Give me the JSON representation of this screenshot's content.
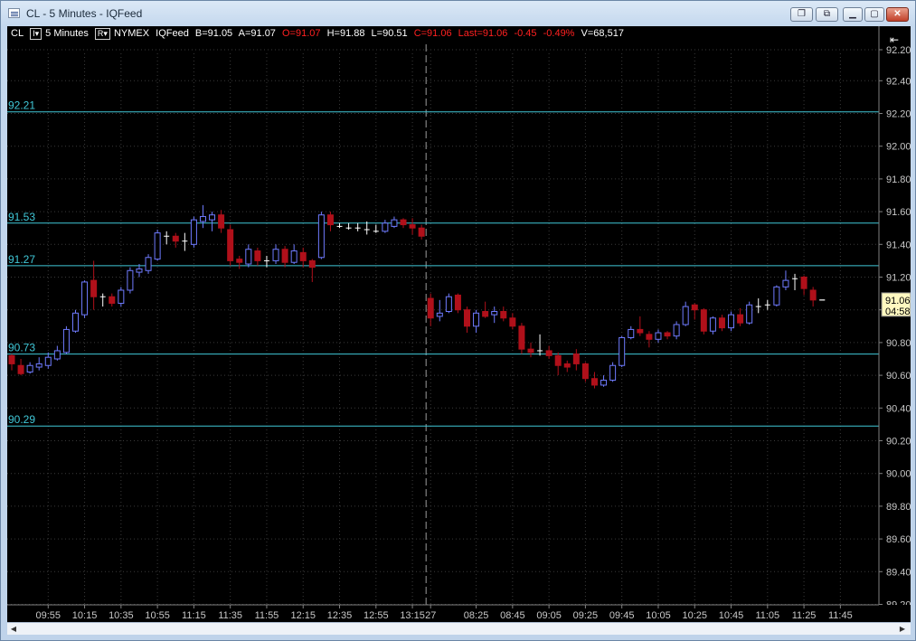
{
  "window": {
    "title": "CL - 5 Minutes - IQFeed",
    "buttons": [
      "restore-window",
      "tile-windows",
      "minimize",
      "maximize",
      "close"
    ]
  },
  "info_bar": {
    "symbol": "CL",
    "interval": "5 Minutes",
    "exchange": "NYMEX",
    "feed": "IQFeed",
    "bid": "B=91.05",
    "ask": "A=91.07",
    "open": "O=91.07",
    "high": "H=91.88",
    "low": "L=90.51",
    "close": "C=91.06",
    "last": "Last=91.06",
    "change": "-0.45",
    "change_pct": "-0.49%",
    "volume": "V=68,517",
    "box1": "I▾",
    "box2": "R▾"
  },
  "colors": {
    "up_candle": "#6f7bff",
    "down_candle": "#b0101a",
    "level_line": "#40c8d8",
    "axis_text": "#c8c8c8",
    "price_tag_bg": "#fff8c0"
  },
  "chart_data": {
    "type": "candlestick",
    "ylim": [
      89.2,
      92.3
    ],
    "y_ticks": [
      "92.20",
      "92.40",
      "92.20",
      "92.00",
      "91.80",
      "91.60",
      "91.40",
      "91.20",
      "91.00",
      "90.80",
      "90.60",
      "90.40",
      "90.20",
      "90.00",
      "89.80",
      "89.60",
      "89.40",
      "89.20"
    ],
    "y_tick_values": [
      92.4,
      92.4,
      92.2,
      92.0,
      91.8,
      91.6,
      91.4,
      91.2,
      91.0,
      90.8,
      90.6,
      90.4,
      90.2,
      90.0,
      89.8,
      89.6,
      89.4,
      89.2
    ],
    "x_ticks": [
      "09:55",
      "10:15",
      "10:35",
      "10:55",
      "11:15",
      "11:35",
      "11:55",
      "12:15",
      "12:35",
      "12:55",
      "13:15",
      "27",
      "08:25",
      "08:45",
      "09:05",
      "09:25",
      "09:45",
      "10:05",
      "10:25",
      "10:45",
      "11:05",
      "11:25",
      "11:45"
    ],
    "x_tick_bar_index": [
      4,
      8,
      12,
      16,
      20,
      24,
      28,
      32,
      36,
      40,
      44,
      46,
      51,
      55,
      59,
      63,
      67,
      71,
      75,
      79,
      83,
      87,
      91
    ],
    "session_break_bar_index": 45.5,
    "levels": [
      {
        "label": "92.21",
        "value": 92.21
      },
      {
        "label": "91.53",
        "value": 91.53
      },
      {
        "label": "91.27",
        "value": 91.27
      },
      {
        "label": "90.73",
        "value": 90.73
      },
      {
        "label": "90.29",
        "value": 90.29
      }
    ],
    "current_price": "91.06",
    "countdown": "04:58",
    "current_value": 91.06,
    "candles": [
      [
        90.72,
        90.73,
        90.63,
        90.67
      ],
      [
        90.66,
        90.7,
        90.6,
        90.61
      ],
      [
        90.62,
        90.68,
        90.61,
        90.66
      ],
      [
        90.65,
        90.71,
        90.63,
        90.67
      ],
      [
        90.66,
        90.74,
        90.64,
        90.71
      ],
      [
        90.7,
        90.78,
        90.69,
        90.75
      ],
      [
        90.74,
        90.9,
        90.73,
        90.88
      ],
      [
        90.87,
        91.0,
        90.86,
        90.98
      ],
      [
        90.97,
        91.18,
        90.95,
        91.17
      ],
      [
        91.18,
        91.3,
        91.0,
        91.08
      ],
      [
        91.07,
        91.1,
        91.02,
        91.08
      ],
      [
        91.08,
        91.1,
        91.02,
        91.04
      ],
      [
        91.04,
        91.14,
        91.02,
        91.12
      ],
      [
        91.12,
        91.26,
        91.1,
        91.24
      ],
      [
        91.23,
        91.28,
        91.2,
        91.25
      ],
      [
        91.24,
        91.34,
        91.22,
        91.32
      ],
      [
        91.31,
        91.49,
        91.3,
        91.47
      ],
      [
        91.46,
        91.48,
        91.4,
        91.45
      ],
      [
        91.45,
        91.47,
        91.38,
        91.42
      ],
      [
        91.41,
        91.47,
        91.36,
        91.42
      ],
      [
        91.4,
        91.57,
        91.38,
        91.55
      ],
      [
        91.54,
        91.64,
        91.5,
        91.57
      ],
      [
        91.55,
        91.6,
        91.48,
        91.58
      ],
      [
        91.58,
        91.61,
        91.47,
        91.5
      ],
      [
        91.49,
        91.52,
        91.27,
        91.3
      ],
      [
        91.31,
        91.33,
        91.25,
        91.29
      ],
      [
        91.28,
        91.4,
        91.26,
        91.37
      ],
      [
        91.36,
        91.38,
        91.27,
        91.3
      ],
      [
        91.29,
        91.33,
        91.26,
        91.3
      ],
      [
        91.3,
        91.4,
        91.28,
        91.37
      ],
      [
        91.37,
        91.39,
        91.26,
        91.29
      ],
      [
        91.29,
        91.4,
        91.28,
        91.36
      ],
      [
        91.35,
        91.38,
        91.26,
        91.3
      ],
      [
        91.3,
        91.31,
        91.17,
        91.26
      ],
      [
        91.32,
        91.6,
        91.31,
        91.58
      ],
      [
        91.58,
        91.6,
        91.48,
        91.52
      ],
      [
        91.52,
        91.53,
        91.5,
        91.51
      ],
      [
        91.51,
        91.53,
        91.49,
        91.5
      ],
      [
        91.5,
        91.53,
        91.48,
        91.5
      ],
      [
        91.5,
        91.54,
        91.46,
        91.49
      ],
      [
        91.49,
        91.52,
        91.47,
        91.48
      ],
      [
        91.48,
        91.55,
        91.47,
        91.53
      ],
      [
        91.51,
        91.57,
        91.5,
        91.55
      ],
      [
        91.55,
        91.56,
        91.5,
        91.52
      ],
      [
        91.52,
        91.56,
        91.46,
        91.5
      ],
      [
        91.5,
        91.52,
        91.43,
        91.45
      ],
      [
        91.07,
        91.1,
        90.9,
        90.95
      ],
      [
        90.96,
        91.06,
        90.93,
        90.98
      ],
      [
        90.99,
        91.1,
        90.98,
        91.08
      ],
      [
        91.09,
        91.1,
        90.98,
        91.0
      ],
      [
        91.0,
        91.02,
        90.86,
        90.9
      ],
      [
        90.9,
        91.0,
        90.86,
        90.98
      ],
      [
        90.99,
        91.05,
        90.95,
        90.96
      ],
      [
        90.97,
        91.02,
        90.92,
        90.99
      ],
      [
        90.99,
        91.02,
        90.93,
        90.95
      ],
      [
        90.95,
        90.98,
        90.88,
        90.9
      ],
      [
        90.9,
        90.92,
        90.73,
        90.76
      ],
      [
        90.76,
        90.8,
        90.71,
        90.74
      ],
      [
        90.74,
        90.85,
        90.72,
        90.75
      ],
      [
        90.75,
        90.78,
        90.7,
        90.72
      ],
      [
        90.72,
        90.74,
        90.6,
        90.66
      ],
      [
        90.67,
        90.69,
        90.62,
        90.65
      ],
      [
        90.73,
        90.76,
        90.63,
        90.67
      ],
      [
        90.67,
        90.68,
        90.56,
        90.58
      ],
      [
        90.58,
        90.62,
        90.52,
        90.54
      ],
      [
        90.54,
        90.6,
        90.53,
        90.57
      ],
      [
        90.57,
        90.68,
        90.56,
        90.66
      ],
      [
        90.66,
        90.84,
        90.65,
        90.83
      ],
      [
        90.83,
        90.9,
        90.82,
        90.88
      ],
      [
        90.88,
        90.96,
        90.84,
        90.86
      ],
      [
        90.85,
        90.87,
        90.77,
        90.82
      ],
      [
        90.82,
        90.88,
        90.8,
        90.86
      ],
      [
        90.86,
        90.87,
        90.82,
        90.84
      ],
      [
        90.84,
        90.93,
        90.82,
        90.91
      ],
      [
        90.91,
        91.05,
        90.9,
        91.02
      ],
      [
        91.03,
        91.04,
        90.94,
        91.0
      ],
      [
        91.0,
        91.01,
        90.85,
        90.87
      ],
      [
        90.87,
        90.96,
        90.85,
        90.95
      ],
      [
        90.95,
        90.97,
        90.87,
        90.89
      ],
      [
        90.89,
        90.99,
        90.87,
        90.97
      ],
      [
        90.97,
        91.01,
        90.9,
        90.92
      ],
      [
        90.92,
        91.05,
        90.91,
        91.03
      ],
      [
        91.03,
        91.07,
        90.98,
        91.02
      ],
      [
        91.02,
        91.06,
        91.0,
        91.03
      ],
      [
        91.03,
        91.15,
        91.02,
        91.14
      ],
      [
        91.14,
        91.24,
        91.12,
        91.18
      ],
      [
        91.19,
        91.22,
        91.12,
        91.19
      ],
      [
        91.2,
        91.21,
        91.09,
        91.13
      ],
      [
        91.12,
        91.14,
        91.02,
        91.06
      ],
      [
        91.06,
        91.06,
        91.06,
        91.06
      ]
    ]
  }
}
